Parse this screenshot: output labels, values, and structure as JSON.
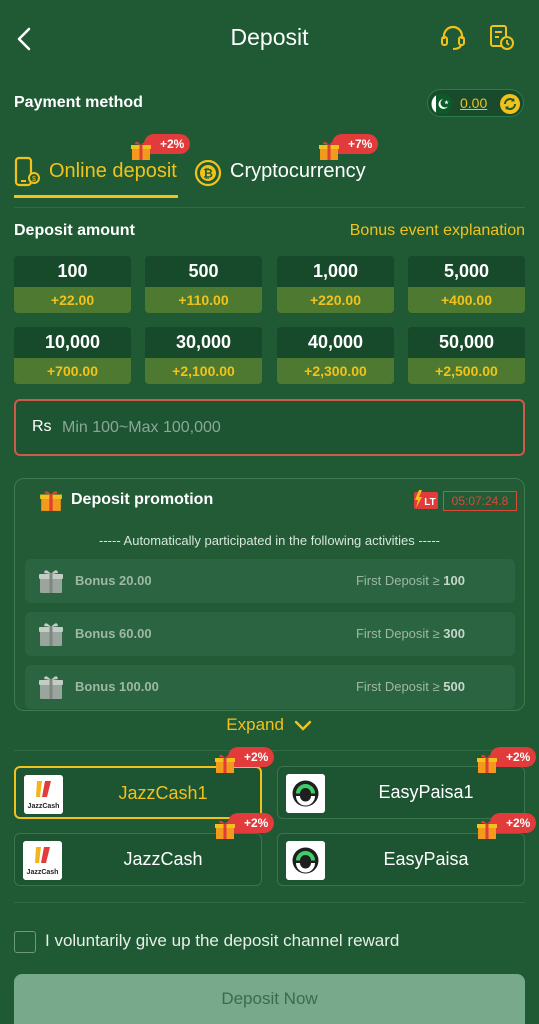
{
  "header": {
    "title": "Deposit"
  },
  "payment": {
    "label": "Payment method",
    "balance": "0.00"
  },
  "tabs": [
    {
      "label": "Online deposit",
      "bonus": "+2%",
      "active": true
    },
    {
      "label": "Cryptocurrency",
      "bonus": "+7%",
      "active": false
    }
  ],
  "deposit": {
    "label": "Deposit amount",
    "bonus_link": "Bonus event explanation",
    "amounts": [
      {
        "value": "100",
        "bonus": "+22.00"
      },
      {
        "value": "500",
        "bonus": "+110.00"
      },
      {
        "value": "1,000",
        "bonus": "+220.00"
      },
      {
        "value": "5,000",
        "bonus": "+400.00"
      },
      {
        "value": "10,000",
        "bonus": "+700.00"
      },
      {
        "value": "30,000",
        "bonus": "+2,100.00"
      },
      {
        "value": "40,000",
        "bonus": "+2,300.00"
      },
      {
        "value": "50,000",
        "bonus": "+2,500.00"
      }
    ],
    "currency": "Rs",
    "placeholder": "Min 100~Max 100,000"
  },
  "promotion": {
    "title": "Deposit promotion",
    "badge": "LT",
    "timer": "05:07:24.8",
    "note": "----- Automatically participated in the following activities -----",
    "items": [
      {
        "bonus": "Bonus 20.00",
        "condition_prefix": "First Deposit ≥",
        "threshold": "100"
      },
      {
        "bonus": "Bonus 60.00",
        "condition_prefix": "First Deposit ≥",
        "threshold": "300"
      },
      {
        "bonus": "Bonus 100.00",
        "condition_prefix": "First Deposit ≥",
        "threshold": "500"
      }
    ],
    "expand": "Expand"
  },
  "channels": [
    {
      "name": "JazzCash1",
      "bonus": "+2%",
      "logo": "jazzcash-logo",
      "selected": true
    },
    {
      "name": "EasyPaisa1",
      "bonus": "+2%",
      "logo": "easypaisa-logo",
      "selected": false
    },
    {
      "name": "JazzCash",
      "bonus": "+2%",
      "logo": "jazzcash-logo",
      "selected": false
    },
    {
      "name": "EasyPaisa",
      "bonus": "+2%",
      "logo": "easypaisa-logo",
      "selected": false
    }
  ],
  "checkbox_label": "I voluntarily give up the deposit channel reward",
  "submit_label": "Deposit Now",
  "colors": {
    "accent": "#f2c21b",
    "background": "#1f5a34",
    "badge": "#e23b3b"
  }
}
